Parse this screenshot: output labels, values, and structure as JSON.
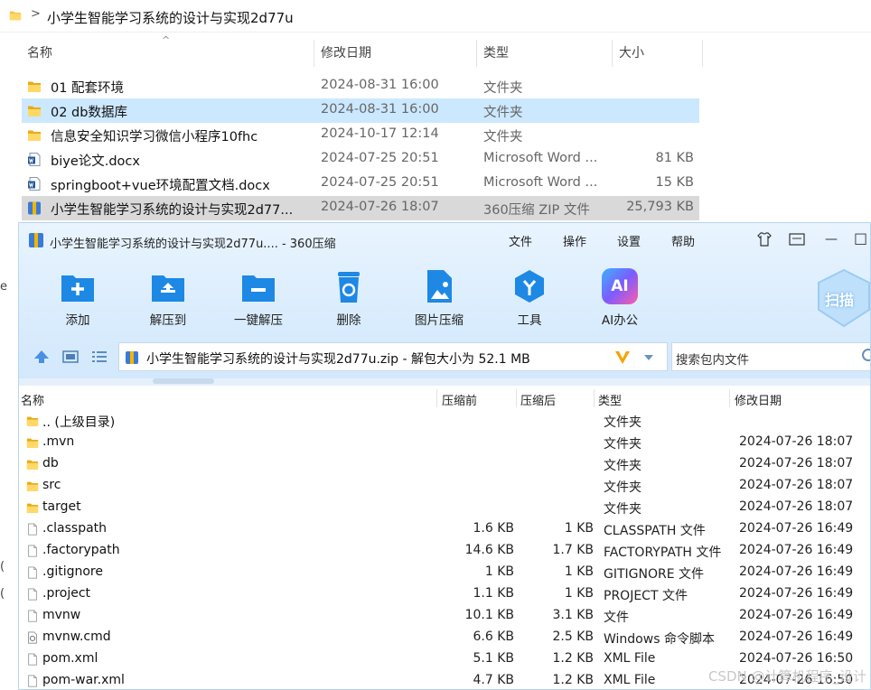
{
  "explorer": {
    "breadcrumb_sep": ">",
    "path": "小学生智能学习系统的设计与实现2d77u",
    "sort_arrow": "^",
    "columns": {
      "name": "名称",
      "date": "修改日期",
      "type": "类型",
      "size": "大小"
    },
    "rows": [
      {
        "name": "01 配套环境",
        "date": "2024-08-31 16:00",
        "type": "文件夹",
        "size": "",
        "icon": "folder-icon",
        "state": ""
      },
      {
        "name": "02 db数据库",
        "date": "2024-08-31 16:00",
        "type": "文件夹",
        "size": "",
        "icon": "folder-icon",
        "state": "selected"
      },
      {
        "name": "信息安全知识学习微信小程序10fhc",
        "date": "2024-10-17 12:14",
        "type": "文件夹",
        "size": "",
        "icon": "folder-icon",
        "state": ""
      },
      {
        "name": "biye论文.docx",
        "date": "2024-07-25 20:51",
        "type": "Microsoft Word ...",
        "size": "81 KB",
        "icon": "word-icon",
        "state": ""
      },
      {
        "name": "springboot+vue环境配置文档.docx",
        "date": "2024-07-25 20:51",
        "type": "Microsoft Word ...",
        "size": "15 KB",
        "icon": "word-icon",
        "state": ""
      },
      {
        "name": "小学生智能学习系统的设计与实现2d77...",
        "date": "2024-07-26 18:07",
        "type": "360压缩 ZIP 文件",
        "size": "25,793 KB",
        "icon": "zip-icon",
        "state": "highlighted"
      }
    ],
    "left_edge_chars": [
      "e",
      "(",
      "("
    ]
  },
  "zip": {
    "title": "小学生智能学习系统的设计与实现2d77u.... - 360压缩",
    "menu": [
      "文件",
      "操作",
      "设置",
      "帮助"
    ],
    "window_controls": {
      "minimize": "—",
      "maximize": "□"
    },
    "tools": [
      {
        "label": "添加",
        "icon": "add-icon"
      },
      {
        "label": "解压到",
        "icon": "extract-to-icon"
      },
      {
        "label": "一键解压",
        "icon": "one-click-extract-icon"
      },
      {
        "label": "删除",
        "icon": "delete-icon"
      },
      {
        "label": "图片压缩",
        "icon": "image-compress-icon"
      },
      {
        "label": "工具",
        "icon": "tools-icon"
      },
      {
        "label": "AI办公",
        "icon": "ai-office-icon"
      }
    ],
    "scan_label": "扫描",
    "ai_badge": "AI",
    "address": "小学生智能学习系统的设计与实现2d77u.zip - 解包大小为 52.1 MB",
    "search_placeholder": "搜索包内文件",
    "columns": {
      "name": "名称",
      "compressed": "压缩前",
      "uncompressed": "压缩后",
      "type": "类型",
      "date": "修改日期"
    },
    "rows": [
      {
        "name": ".. (上级目录)",
        "cs": "",
        "us": "",
        "type": "文件夹",
        "date": "",
        "icon": "folder-icon"
      },
      {
        "name": ".mvn",
        "cs": "",
        "us": "",
        "type": "文件夹",
        "date": "2024-07-26 18:07",
        "icon": "folder-icon"
      },
      {
        "name": "db",
        "cs": "",
        "us": "",
        "type": "文件夹",
        "date": "2024-07-26 18:07",
        "icon": "folder-icon"
      },
      {
        "name": "src",
        "cs": "",
        "us": "",
        "type": "文件夹",
        "date": "2024-07-26 18:07",
        "icon": "folder-icon"
      },
      {
        "name": "target",
        "cs": "",
        "us": "",
        "type": "文件夹",
        "date": "2024-07-26 18:07",
        "icon": "folder-icon"
      },
      {
        "name": ".classpath",
        "cs": "1.6 KB",
        "us": "1 KB",
        "type": "CLASSPATH 文件",
        "date": "2024-07-26 16:49",
        "icon": "file-icon"
      },
      {
        "name": ".factorypath",
        "cs": "14.6 KB",
        "us": "1.7 KB",
        "type": "FACTORYPATH 文件",
        "date": "2024-07-26 16:49",
        "icon": "file-icon"
      },
      {
        "name": ".gitignore",
        "cs": "1 KB",
        "us": "1 KB",
        "type": "GITIGNORE 文件",
        "date": "2024-07-26 16:49",
        "icon": "file-icon"
      },
      {
        "name": ".project",
        "cs": "1.1 KB",
        "us": "1 KB",
        "type": "PROJECT 文件",
        "date": "2024-07-26 16:49",
        "icon": "file-icon"
      },
      {
        "name": "mvnw",
        "cs": "10.1 KB",
        "us": "3.1 KB",
        "type": "文件",
        "date": "2024-07-26 16:49",
        "icon": "file-icon"
      },
      {
        "name": "mvnw.cmd",
        "cs": "6.6 KB",
        "us": "2.5 KB",
        "type": "Windows 命令脚本",
        "date": "2024-07-26 16:49",
        "icon": "script-icon"
      },
      {
        "name": "pom.xml",
        "cs": "5.1 KB",
        "us": "1.2 KB",
        "type": "XML File",
        "date": "2024-07-26 16:50",
        "icon": "file-icon"
      },
      {
        "name": "pom-war.xml",
        "cs": "4.7 KB",
        "us": "1.2 KB",
        "type": "XML File",
        "date": "2024-07-26 16:50",
        "icon": "file-icon"
      }
    ],
    "watermark": "CSDN @计算机程序_设计"
  },
  "colors": {
    "accent": "#1e88e5",
    "folder": "#f6c543",
    "selected_row": "#cce8ff",
    "highlighted_row": "#d9d9d9"
  }
}
